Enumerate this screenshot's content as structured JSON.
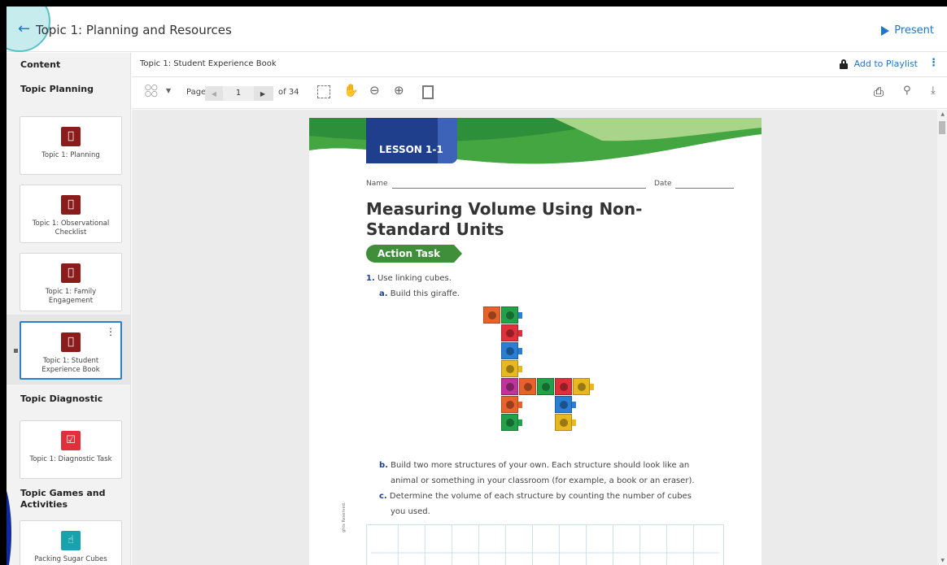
{
  "header": {
    "title": "Topic 1: Planning and Resources",
    "present_label": "Present",
    "back_icon": "arrow-left-icon"
  },
  "sidebar": {
    "content_label": "Content",
    "sections": [
      {
        "title": "Topic Planning"
      },
      {
        "title": "Topic Diagnostic"
      },
      {
        "title": "Topic Games and Activities"
      }
    ],
    "cards": [
      {
        "label": "Topic 1: Planning",
        "icon": "apple-icon",
        "color": "#8b1c1c"
      },
      {
        "label": "Topic 1: Observational Checklist",
        "icon": "apple-icon",
        "color": "#8b1c1c"
      },
      {
        "label": "Topic 1: Family Engagement",
        "icon": "apple-icon",
        "color": "#8b1c1c"
      },
      {
        "label": "Topic 1: Student Experience Book",
        "icon": "apple-icon",
        "color": "#8b1c1c",
        "selected": true
      },
      {
        "label": "Topic 1: Diagnostic Task",
        "icon": "checkbox-icon",
        "color": "#e0303c"
      },
      {
        "label": "Packing Sugar Cubes",
        "icon": "pointer-hand-icon",
        "color": "#18a2ac"
      }
    ]
  },
  "docbar": {
    "title": "Topic 1: Student Experience Book",
    "add_to_playlist": "Add to Playlist"
  },
  "toolbar": {
    "page_label": "Page",
    "page_value": "1",
    "page_total": "of 34"
  },
  "document": {
    "lesson": "LESSON 1-1",
    "name_label": "Name",
    "date_label": "Date",
    "title": "Measuring Volume Using Non-Standard Units",
    "action_task": "Action Task",
    "q1_num": "1.",
    "q1_text": "Use linking cubes.",
    "qa_letter": "a.",
    "qa_text": "Build this giraffe.",
    "qb_letter": "b.",
    "qb_text1": "Build two more structures of your own. Each structure should look like an",
    "qb_text2": "animal or something in your classroom (for example, a book or an eraser).",
    "qc_letter": "c.",
    "qc_text1": "Determine the volume of each structure by counting the number of cubes",
    "qc_text2": "you used.",
    "copyright": "ghts Reserved."
  },
  "colors": {
    "accent": "#1f76c7",
    "lesson_blue": "#1f3f8c",
    "action_green": "#3e8e3a"
  }
}
